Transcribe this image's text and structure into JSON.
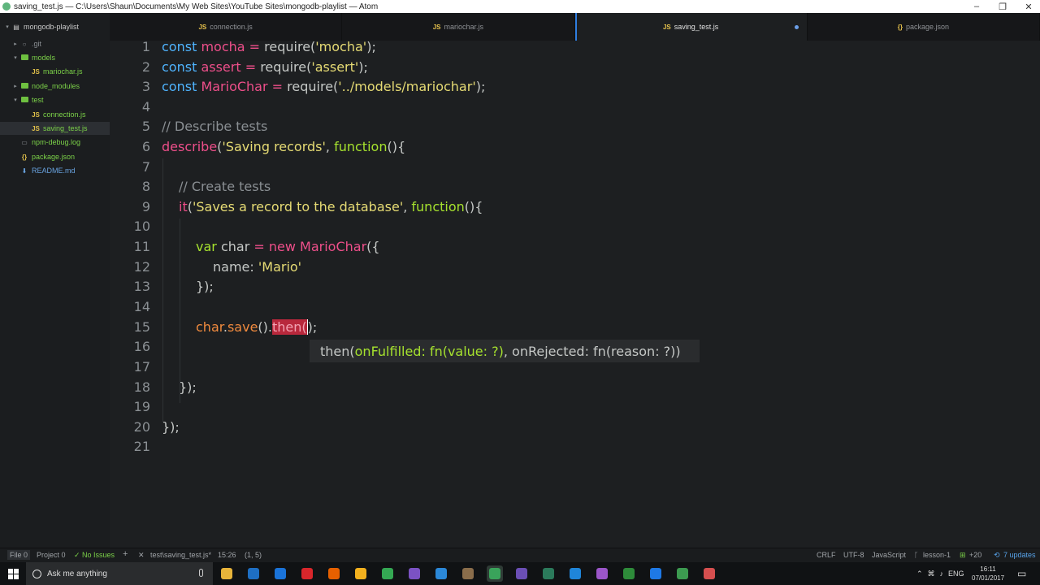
{
  "window": {
    "title": "saving_test.js — C:\\Users\\Shaun\\Documents\\My Web Sites\\YouTube Sites\\mongodb-playlist — Atom",
    "minimize_glyph": "–",
    "restore_glyph": "❐",
    "close_glyph": "✕"
  },
  "tree": {
    "root": "mongodb-playlist",
    "items": [
      {
        "label": ".git",
        "type": "folder",
        "depth": 1,
        "expanded": false,
        "dim": true
      },
      {
        "label": "models",
        "type": "folder",
        "depth": 1,
        "expanded": true
      },
      {
        "label": "mariochar.js",
        "type": "js",
        "depth": 2
      },
      {
        "label": "node_modules",
        "type": "folder",
        "depth": 1,
        "expanded": false
      },
      {
        "label": "test",
        "type": "folder",
        "depth": 1,
        "expanded": true
      },
      {
        "label": "connection.js",
        "type": "js",
        "depth": 2
      },
      {
        "label": "saving_test.js",
        "type": "js",
        "depth": 2,
        "selected": true
      },
      {
        "label": "npm-debug.log",
        "type": "file",
        "depth": 1
      },
      {
        "label": "package.json",
        "type": "json",
        "depth": 1
      },
      {
        "label": "README.md",
        "type": "md",
        "depth": 1
      }
    ]
  },
  "tabs": [
    {
      "label": "connection.js",
      "icon": "JS",
      "active": false
    },
    {
      "label": "mariochar.js",
      "icon": "JS",
      "active": false
    },
    {
      "label": "saving_test.js",
      "icon": "JS",
      "active": true,
      "modified": true
    },
    {
      "label": "package.json",
      "icon": "{}",
      "active": false
    }
  ],
  "editor": {
    "line_numbers": [
      "1",
      "2",
      "3",
      "4",
      "5",
      "6",
      "7",
      "8",
      "9",
      "10",
      "11",
      "12",
      "13",
      "14",
      "15",
      "16",
      "17",
      "18",
      "19",
      "20",
      "21"
    ],
    "code": {
      "l1": {
        "kw": "const",
        "name": "mocha",
        "op": "=",
        "fn": "require(",
        "str": "'mocha'",
        "end": ");"
      },
      "l2": {
        "kw": "const",
        "name": "assert",
        "op": "=",
        "fn": "require(",
        "str": "'assert'",
        "end": ");"
      },
      "l3": {
        "kw": "const",
        "name": "MarioChar",
        "op": "=",
        "fn": "require(",
        "str": "'../models/mariochar'",
        "end": ");"
      },
      "l5": {
        "comment": "// Describe tests"
      },
      "l6": {
        "fn": "describe",
        "open": "(",
        "str": "'Saving records'",
        "comma": ",",
        "kw": "function",
        "end": "(){"
      },
      "l8": {
        "comment": "// Create tests"
      },
      "l9": {
        "fn": "it",
        "open": "(",
        "str": "'Saves a record to the database'",
        "comma": ",",
        "kw": "function",
        "end": "(){"
      },
      "l11": {
        "kw": "var",
        "name": "char",
        "op": "=",
        "kw2": "new",
        "cls": "MarioChar",
        "end": "({"
      },
      "l12": {
        "prop": "name:",
        "str": "'Mario'"
      },
      "l13": {
        "text": "});"
      },
      "l15": {
        "obj": "char",
        "dot1": ".",
        "method1": "save",
        "paren1": "()",
        "dot2": ".",
        "method2": "then",
        "paren2": "(",
        "cursor": ")",
        "semi": ";"
      },
      "l18": {
        "text": "});"
      },
      "l20": {
        "text": "});"
      }
    },
    "autocomplete": {
      "prefix": "then(",
      "param1": "onFulfilled: fn(value: ?)",
      "sep": ", ",
      "param2": "onRejected: fn(reason: ?)",
      "suffix": ")"
    }
  },
  "statusbar": {
    "file": "File 0",
    "project": "Project 0",
    "issues": "✓ No Issues",
    "plus": "+",
    "close_x": "✕",
    "path": "test\\saving_test.js*",
    "cursor_pos": "15:26",
    "selection": "(1, 5)",
    "line_ending": "CRLF",
    "encoding": "UTF-8",
    "grammar": "JavaScript",
    "branch": "lesson-1",
    "git_changes": "+20",
    "updates": "7 updates"
  },
  "taskbar": {
    "search_placeholder": "Ask me anything",
    "language": "ENG",
    "time": "16:11",
    "date": "07/01/2017",
    "app_colors": [
      "#e8b43a",
      "#1e6fc4",
      "#1a73d9",
      "#d9262b",
      "#e66000",
      "#f3b11e",
      "#34a853",
      "#7b52c4",
      "#2b88d8",
      "#8a6d4b",
      "#3aa35b",
      "#6b4fb5",
      "#2b7a5b",
      "#1f85d9",
      "#9b56c9",
      "#2e8b3a",
      "#1e79e6",
      "#3c9a50",
      "#d64f4f"
    ]
  },
  "colors": {
    "accent": "#2f7ee0",
    "editor_bg": "#1d1f21",
    "highlight": "#b8283c"
  }
}
